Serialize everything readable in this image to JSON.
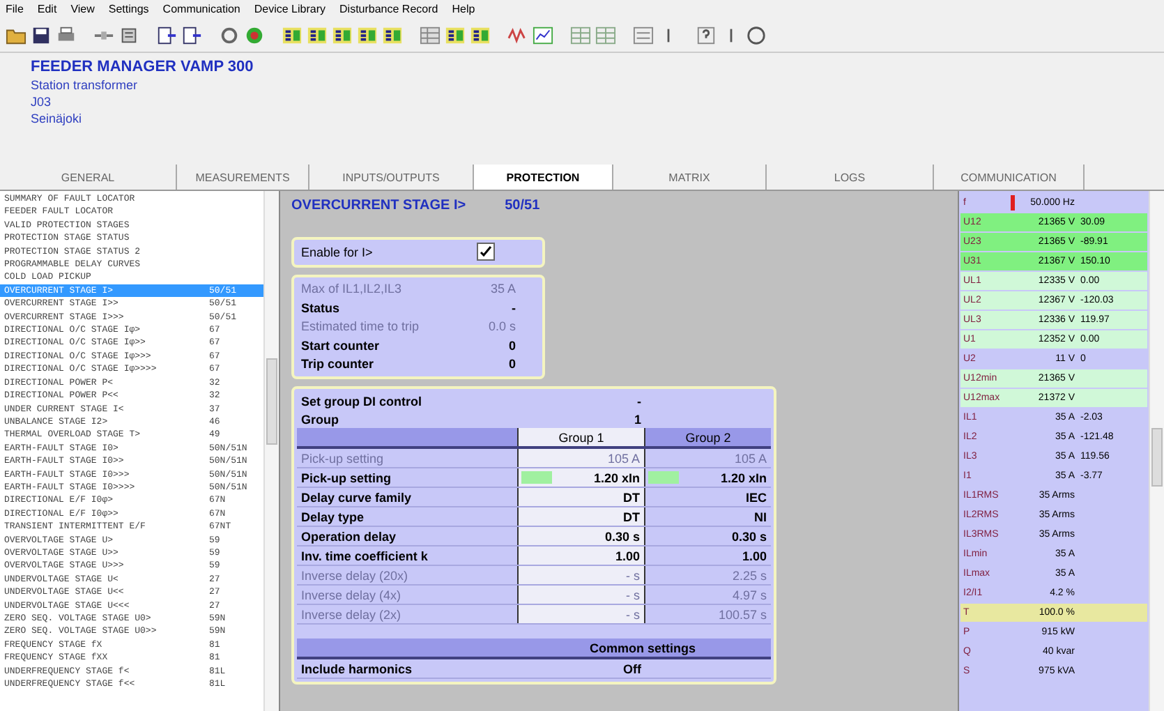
{
  "menu": [
    "File",
    "Edit",
    "View",
    "Settings",
    "Communication",
    "Device Library",
    "Disturbance Record",
    "Help"
  ],
  "device": {
    "title": "FEEDER MANAGER VAMP 300",
    "lines": [
      "Station transformer",
      "J03",
      "Seinäjoki"
    ]
  },
  "tabs": [
    {
      "label": "GENERAL",
      "selected": false
    },
    {
      "label": "MEASUREMENTS",
      "selected": false
    },
    {
      "label": "INPUTS/OUTPUTS",
      "selected": false
    },
    {
      "label": "PROTECTION",
      "selected": true
    },
    {
      "label": "MATRIX",
      "selected": false
    },
    {
      "label": "LOGS",
      "selected": false
    },
    {
      "label": "COMMUNICATION",
      "selected": false
    }
  ],
  "menu_list": [
    {
      "label": "SUMMARY OF FAULT LOCATOR",
      "selected": false
    },
    {
      "label": "FEEDER FAULT LOCATOR",
      "selected": false
    },
    {
      "label": "VALID PROTECTION STAGES",
      "selected": false
    },
    {
      "label": "PROTECTION STAGE STATUS",
      "selected": false
    },
    {
      "label": "PROTECTION STAGE STATUS 2",
      "selected": false
    },
    {
      "label": "PROGRAMMABLE DELAY CURVES",
      "selected": false
    },
    {
      "label": "COLD LOAD PICKUP",
      "selected": false
    },
    {
      "label": "OVERCURRENT STAGE I>",
      "code": "50/51",
      "selected": true
    },
    {
      "label": "OVERCURRENT STAGE I>>",
      "code": "50/51",
      "selected": false
    },
    {
      "label": "OVERCURRENT STAGE I>>>",
      "code": "50/51",
      "selected": false
    },
    {
      "label": "DIRECTIONAL O/C STAGE Iφ>",
      "code": "67",
      "selected": false
    },
    {
      "label": "DIRECTIONAL O/C STAGE Iφ>>",
      "code": "67",
      "selected": false
    },
    {
      "label": "DIRECTIONAL O/C STAGE Iφ>>>",
      "code": "67",
      "selected": false
    },
    {
      "label": "DIRECTIONAL O/C STAGE Iφ>>>>",
      "code": "67",
      "selected": false
    },
    {
      "label": "DIRECTIONAL POWER P<",
      "code": "32",
      "selected": false
    },
    {
      "label": "DIRECTIONAL POWER P<<",
      "code": "32",
      "selected": false
    },
    {
      "label": "UNDER CURRENT STAGE I<",
      "code": "37",
      "selected": false
    },
    {
      "label": "UNBALANCE STAGE I2>",
      "code": "46",
      "selected": false
    },
    {
      "label": "THERMAL OVERLOAD STAGE T>",
      "code": "49",
      "selected": false
    },
    {
      "label": "EARTH-FAULT STAGE I0>",
      "code": "50N/51N",
      "selected": false
    },
    {
      "label": "EARTH-FAULT STAGE I0>>",
      "code": "50N/51N",
      "selected": false
    },
    {
      "label": "EARTH-FAULT STAGE I0>>>",
      "code": "50N/51N",
      "selected": false
    },
    {
      "label": "EARTH-FAULT STAGE I0>>>>",
      "code": "50N/51N",
      "selected": false
    },
    {
      "label": "DIRECTIONAL E/F I0φ>",
      "code": "67N",
      "selected": false
    },
    {
      "label": "DIRECTIONAL E/F I0φ>>",
      "code": "67N",
      "selected": false
    },
    {
      "label": "TRANSIENT INTERMITTENT E/F",
      "code": "67NT",
      "selected": false
    },
    {
      "label": "OVERVOLTAGE STAGE U>",
      "code": "59",
      "selected": false
    },
    {
      "label": "OVERVOLTAGE STAGE U>>",
      "code": "59",
      "selected": false
    },
    {
      "label": "OVERVOLTAGE STAGE U>>>",
      "code": "59",
      "selected": false
    },
    {
      "label": "UNDERVOLTAGE STAGE U<",
      "code": "27",
      "selected": false
    },
    {
      "label": "UNDERVOLTAGE STAGE U<<",
      "code": "27",
      "selected": false
    },
    {
      "label": "UNDERVOLTAGE STAGE U<<<",
      "code": "27",
      "selected": false
    },
    {
      "label": "ZERO SEQ. VOLTAGE STAGE U0>",
      "code": "59N",
      "selected": false
    },
    {
      "label": "ZERO SEQ. VOLTAGE STAGE U0>>",
      "code": "59N",
      "selected": false
    },
    {
      "label": "FREQUENCY STAGE fX",
      "code": "81",
      "selected": false
    },
    {
      "label": "FREQUENCY STAGE fXX",
      "code": "81",
      "selected": false
    },
    {
      "label": "UNDERFREQUENCY STAGE f<",
      "code": "81L",
      "selected": false
    },
    {
      "label": "UNDERFREQUENCY STAGE f<<",
      "code": "81L",
      "selected": false
    }
  ],
  "stage": {
    "title": "OVERCURRENT STAGE I>",
    "code": "50/51",
    "enable": {
      "label": "Enable for I>",
      "checked": true
    },
    "status_rows": [
      {
        "label": "Max of IL1,IL2,IL3",
        "value": "35  A",
        "disabled": true
      },
      {
        "label": "Status",
        "value": "-",
        "disabled": false
      },
      {
        "label": "Estimated time to trip",
        "value": "0.0  s",
        "disabled": true
      },
      {
        "label": "Start counter",
        "value": "0",
        "disabled": false
      },
      {
        "label": "Trip counter",
        "value": "0",
        "disabled": false
      }
    ],
    "group_rows": [
      {
        "label": "Set group DI control",
        "value": "-"
      },
      {
        "label": "Group",
        "value": "1"
      }
    ],
    "columns": [
      "Group 1",
      "Group 2"
    ],
    "settings": [
      {
        "label": "Pick-up setting",
        "values": [
          "105  A",
          "105  A"
        ],
        "disabled": true,
        "marked": false
      },
      {
        "label": "Pick-up setting",
        "values": [
          "1.20  xIn",
          "1.20  xIn"
        ],
        "disabled": false,
        "marked": true
      },
      {
        "label": "Delay curve family",
        "values": [
          "DT",
          "IEC"
        ],
        "disabled": false,
        "marked": false
      },
      {
        "label": "Delay type",
        "values": [
          "DT",
          "NI"
        ],
        "disabled": false,
        "marked": false
      },
      {
        "label": "Operation delay",
        "values": [
          "0.30  s",
          "0.30  s"
        ],
        "disabled": false,
        "marked": false
      },
      {
        "label": "Inv. time coefficient k",
        "values": [
          "1.00",
          "1.00"
        ],
        "disabled": false,
        "marked": false
      },
      {
        "label": "Inverse delay (20x)",
        "values": [
          "-  s",
          "2.25  s"
        ],
        "disabled": true,
        "marked": false
      },
      {
        "label": "Inverse delay (4x)",
        "values": [
          "-  s",
          "4.97  s"
        ],
        "disabled": true,
        "marked": false
      },
      {
        "label": "Inverse delay (2x)",
        "values": [
          "-  s",
          "100.57  s"
        ],
        "disabled": true,
        "marked": false
      }
    ],
    "common_header": "Common settings",
    "common_rows": [
      {
        "label": "Include harmonics",
        "value": "Off"
      }
    ]
  },
  "measurements": [
    {
      "label": "f",
      "value": "50.000 Hz",
      "color": "#c8c8f8",
      "marker": true
    },
    {
      "label": "U12",
      "value": "21365 V",
      "extra": "30.09",
      "color": "#80f080",
      "marker": false
    },
    {
      "label": "U23",
      "value": "21365 V",
      "extra": "-89.91",
      "color": "#80f080",
      "marker": false
    },
    {
      "label": "U31",
      "value": "21367 V",
      "extra": "150.10",
      "color": "#80f080",
      "marker": false
    },
    {
      "label": "UL1",
      "value": "12335 V",
      "extra": "0.00",
      "color": "#d0f8d8",
      "marker": false
    },
    {
      "label": "UL2",
      "value": "12367 V",
      "extra": "-120.03",
      "color": "#d0f8d8",
      "marker": false
    },
    {
      "label": "UL3",
      "value": "12336 V",
      "extra": "119.97",
      "color": "#d0f8d8",
      "marker": false
    },
    {
      "label": "U1",
      "value": "12352 V",
      "extra": "0.00",
      "color": "#d0f8d8",
      "marker": false
    },
    {
      "label": "U2",
      "value": "11 V",
      "extra": "0",
      "color": "#c8c8f8",
      "marker": false
    },
    {
      "label": "U12min",
      "value": "21365 V",
      "color": "#d0f8d8",
      "marker": false
    },
    {
      "label": "U12max",
      "value": "21372 V",
      "color": "#d0f8d8",
      "marker": false
    },
    {
      "label": "IL1",
      "value": "35 A",
      "extra": "-2.03",
      "color": "#c8c8f8",
      "marker": false
    },
    {
      "label": "IL2",
      "value": "35 A",
      "extra": "-121.48",
      "color": "#c8c8f8",
      "marker": false
    },
    {
      "label": "IL3",
      "value": "35 A",
      "extra": "119.56",
      "color": "#c8c8f8",
      "marker": false
    },
    {
      "label": "I1",
      "value": "35 A",
      "extra": "-3.77",
      "color": "#c8c8f8",
      "marker": false
    },
    {
      "label": "IL1RMS",
      "value": "35 Arms",
      "color": "#c8c8f8",
      "marker": false
    },
    {
      "label": "IL2RMS",
      "value": "35 Arms",
      "color": "#c8c8f8",
      "marker": false
    },
    {
      "label": "IL3RMS",
      "value": "35 Arms",
      "color": "#c8c8f8",
      "marker": false
    },
    {
      "label": "ILmin",
      "value": "35 A",
      "color": "#c8c8f8",
      "marker": false
    },
    {
      "label": "ILmax",
      "value": "35 A",
      "color": "#c8c8f8",
      "marker": false
    },
    {
      "label": "I2/I1",
      "value": "4.2 %",
      "color": "#c8c8f8",
      "marker": false
    },
    {
      "label": "T",
      "value": "100.0 %",
      "color": "#e8e8a0",
      "marker": false
    },
    {
      "label": "P",
      "value": "915 kW",
      "color": "#c8c8f8",
      "marker": false
    },
    {
      "label": "Q",
      "value": "40 kvar",
      "color": "#c8c8f8",
      "marker": false
    },
    {
      "label": "S",
      "value": "975 kVA",
      "color": "#c8c8f8",
      "marker": false
    }
  ]
}
